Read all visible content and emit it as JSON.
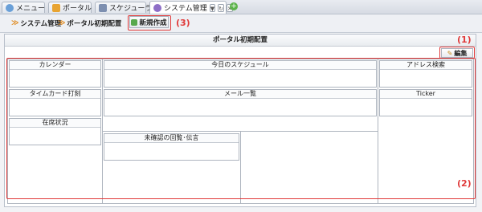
{
  "tabs": [
    {
      "label": "メニュー",
      "icon": "menu-icon",
      "color": "#6aa0d8"
    },
    {
      "label": "ポータル",
      "icon": "portal-icon",
      "color": "#e8a432"
    },
    {
      "label": "スケジューラ",
      "icon": "calendar-icon",
      "color": "#7d8fb0"
    },
    {
      "label": "システム管理",
      "icon": "gear-icon",
      "color": "#8e6fc7",
      "active": true
    }
  ],
  "tab_controls": {
    "menu": "▼",
    "reload": "↻",
    "close": "✕"
  },
  "breadcrumb": [
    "システム管理",
    "ポータル初期配置"
  ],
  "new_button": "新規作成",
  "callouts": {
    "edit": "(1)",
    "layout": "(2)",
    "new": "(3)"
  },
  "panel": {
    "title": "ポータル初期配置",
    "edit_button": "編集"
  },
  "portlets": {
    "calendar": "カレンダー",
    "timecard": "タイムカード打刻",
    "presence": "在席状況",
    "today_schedule": "今日のスケジュール",
    "mail": "メール一覧",
    "unconfirmed": "未確認の回覧･伝言",
    "address": "アドレス検索",
    "ticker": "Ticker"
  },
  "colors": {
    "accent_red": "#e03a3a",
    "border": "#aeb5bf",
    "crumb_arrow": "#e08a1e"
  }
}
